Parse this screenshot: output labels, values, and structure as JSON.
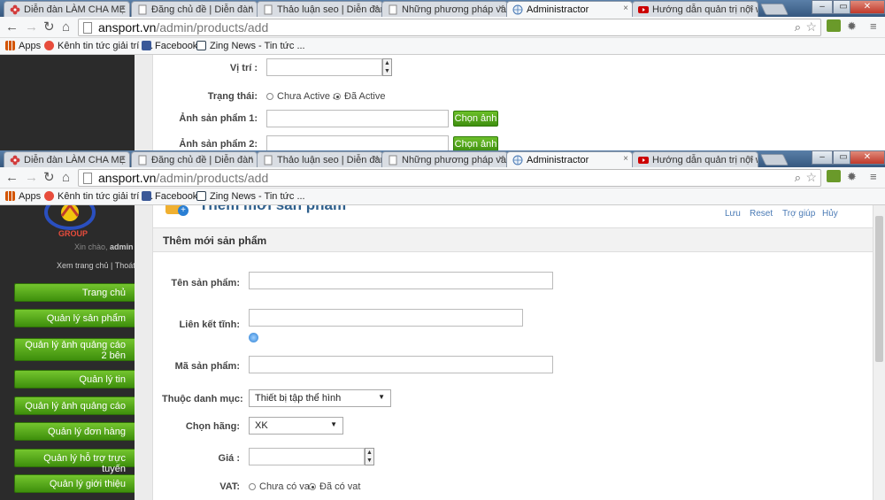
{
  "browser": {
    "tabs": [
      {
        "label": "Diễn đàn LÀM CHA MẸ",
        "icon": "flower-icon",
        "color": "#d23b3b"
      },
      {
        "label": "Đăng chủ đề | Diễn đàn SEO",
        "icon": "page-icon",
        "color": "#888888"
      },
      {
        "label": "Thảo luận seo | Diễn đàn SEO",
        "icon": "page-icon",
        "color": "#888888"
      },
      {
        "label": "Những phương pháp và thủ",
        "icon": "page-icon",
        "color": "#888888"
      },
      {
        "label": "Administractor",
        "icon": "globe-icon",
        "color": "#4a7ab5"
      },
      {
        "label": "Hướng dẫn quản trị nội w",
        "icon": "youtube-icon",
        "color": "#cc0000"
      }
    ],
    "url_host": "ansport.vn",
    "url_path": "/admin/products/add",
    "window_controls": [
      "–",
      "▭",
      "✕"
    ],
    "bookmarks": [
      {
        "label": "Apps",
        "icon": "apps-grid-icon",
        "color": "#d35400"
      },
      {
        "label": "Kênh tin tức giải trí -...",
        "icon": "news-icon",
        "color": "#e74c3c"
      },
      {
        "label": "Facebook",
        "icon": "facebook-icon",
        "color": "#3b5998"
      },
      {
        "label": "Zing News - Tin tức ...",
        "icon": "zing-icon",
        "color": "#2c3e50"
      }
    ]
  },
  "top_form": {
    "vitri_label": "Vị trí :",
    "trangthai_label": "Trạng thái:",
    "status_inactive": "Chưa Active a",
    "status_active": "Đã Active",
    "anh1_label": "Ảnh sản phẩm 1:",
    "anh2_label": "Ảnh sản phẩm 2:",
    "choose_image": "Chọn ảnh"
  },
  "sidebar": {
    "greeting": "Xin chào,",
    "username": "admin",
    "view_home": "Xem trang chủ",
    "sep": "|",
    "logout": "Thoát",
    "menu": [
      "Trang chủ",
      "Quản lý sản phẩm",
      "Quản lý ảnh quảng cáo 2 bên",
      "Quản lý tin",
      "Quản lý ảnh quảng cáo",
      "Quản lý đơn hàng",
      "Quản lý hỗ trợ trực tuyến",
      "Quản lý giới thiệu"
    ]
  },
  "main": {
    "page_heading": "Thêm mới sản phẩm",
    "actions": [
      "Lưu",
      "Reset",
      "Trợ giúp",
      "Hủy"
    ],
    "section_title": "Thêm mới sản phẩm",
    "ten_label": "Tên sản phẩm:",
    "lienket_label": "Liên kết tĩnh:",
    "ma_label": "Mã sản phẩm:",
    "danhmuc_label": "Thuộc danh mục:",
    "danhmuc_value": "Thiết bị tập thể hình",
    "hang_label": "Chọn hãng:",
    "hang_value": "XK",
    "gia_label": "Giá :",
    "vat_label": "VAT:",
    "vat_no": "Chưa có vat",
    "vat_yes": "Đã có vat"
  }
}
